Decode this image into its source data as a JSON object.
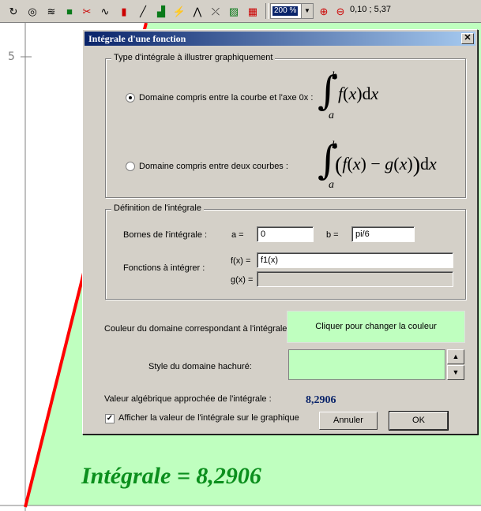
{
  "toolbar": {
    "icons": [
      "spiral-icon",
      "wave-icon",
      "cube-icon",
      "scissors-icon",
      "sine-icon",
      "bar-chart-icon",
      "line-icon",
      "histogram-icon",
      "yield-icon",
      "normal-curve-icon",
      "tangent-icon",
      "hatch-icon",
      "grid-icon"
    ],
    "zoom_value": "200 %",
    "coords": "0,10 ; 5,37"
  },
  "graph": {
    "y_tick_label": "5",
    "fill_color": "#bfffbf",
    "curve_color": "#ff0000",
    "result_text": "Intégrale = 8,2906"
  },
  "dialog": {
    "title": "Intégrale d'une fonction",
    "type_group": {
      "title": "Type d'intégrale à illustrer graphiquement",
      "option1_label": "Domaine compris entre la courbe et l'axe 0x :",
      "option1_checked": true,
      "option2_label": "Domaine compris entre deux courbes :",
      "option2_checked": false,
      "formula_upper": "b",
      "formula_lower": "a",
      "formula1_func": "f",
      "formula1_var": "x",
      "formula2_f": "f",
      "formula2_g": "g",
      "formula2_var": "x",
      "minus": "−",
      "d": "d"
    },
    "definition_group": {
      "title": "Définition de l'intégrale",
      "bounds_label": "Bornes de l'intégrale :",
      "a_label": "a =",
      "a_value": "0",
      "b_label": "b =",
      "b_value": "pi/6",
      "functions_label": "Fonctions à intégrer :",
      "f_label": "f(x) =",
      "f_value": "f1(x)",
      "g_label": "g(x) =",
      "g_value": ""
    },
    "color_label": "Couleur du domaine correspondant à l'intégrale :",
    "color_button": "Cliquer pour changer la couleur",
    "domain_color": "#bfffbf",
    "hatch_label": "Style du domaine hachuré:",
    "approx_label": "Valeur algébrique approchée de l'intégrale :",
    "approx_value": "8,2906",
    "show_value_label": "Afficher la valeur de l'intégrale sur le graphique",
    "show_value_checked": true,
    "cancel_button": "Annuler",
    "ok_button": "OK"
  }
}
